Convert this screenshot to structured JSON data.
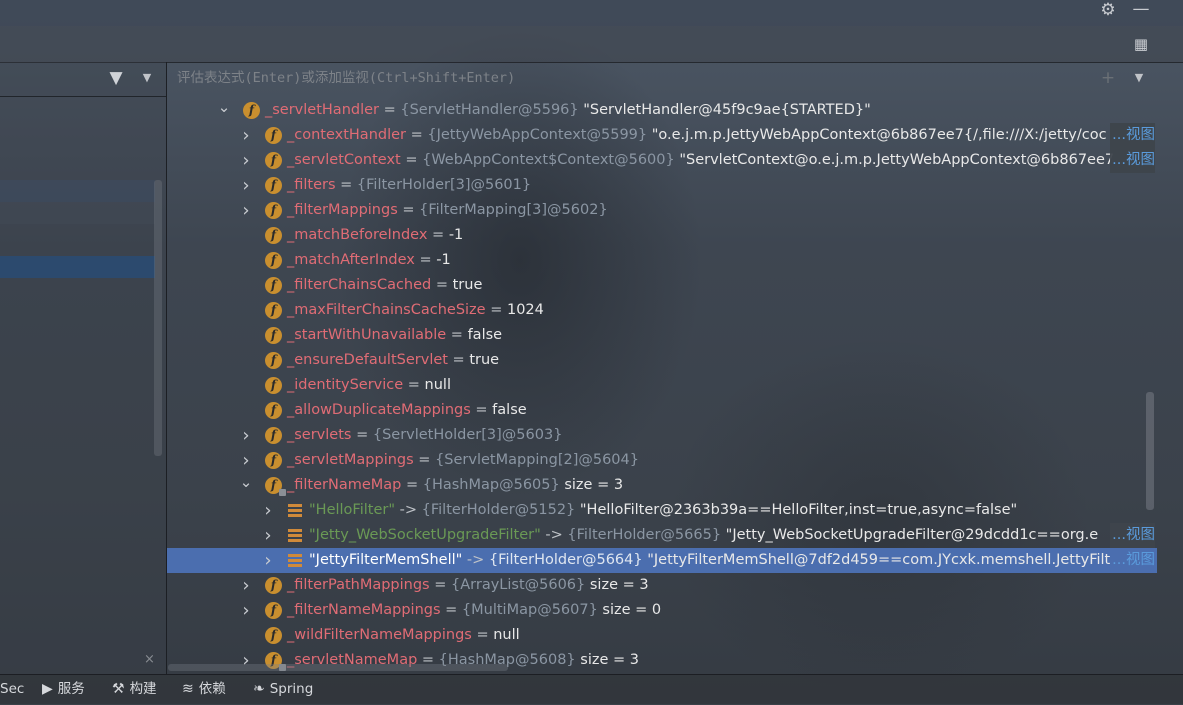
{
  "window": {
    "settings_icon": "gear-icon",
    "minimize_icon": "minimize-icon",
    "layout_icon": "layout-icon"
  },
  "frames_panel": {
    "filter_icon": "filter-icon",
    "close_glyph": "×"
  },
  "watches": {
    "placeholder": "评估表达式(Enter)或添加监视(Ctrl+Shift+Enter)",
    "add_glyph": "+"
  },
  "tree": [
    {
      "indent": 0,
      "toggle": "expanded",
      "icon": "field",
      "name": "_servletHandler",
      "sep": " = ",
      "ref": "{ServletHandler@5596}",
      "value": " \"ServletHandler@45f9c9ae{STARTED}\"",
      "view": ""
    },
    {
      "indent": 1,
      "toggle": "collapsed",
      "icon": "field",
      "name": "_contextHandler",
      "sep": " = ",
      "ref": "{JettyWebAppContext@5599}",
      "value": " \"o.e.j.m.p.JettyWebAppContext@6b867ee7{/,file:///X:/jetty/coc",
      "view": "...视图"
    },
    {
      "indent": 1,
      "toggle": "collapsed",
      "icon": "field",
      "name": "_servletContext",
      "sep": " = ",
      "ref": "{WebAppContext$Context@5600}",
      "value": " \"ServletContext@o.e.j.m.p.JettyWebAppContext@6b867ee7",
      "view": "...视图"
    },
    {
      "indent": 1,
      "toggle": "collapsed",
      "icon": "field",
      "name": "_filters",
      "sep": " = ",
      "ref": "{FilterHolder[3]@5601}",
      "value": "",
      "view": ""
    },
    {
      "indent": 1,
      "toggle": "collapsed",
      "icon": "field",
      "name": "_filterMappings",
      "sep": " = ",
      "ref": "{FilterMapping[3]@5602}",
      "value": "",
      "view": ""
    },
    {
      "indent": 1,
      "toggle": "none",
      "icon": "field",
      "name": "_matchBeforeIndex",
      "sep": " = ",
      "ref": "",
      "value": "-1",
      "view": ""
    },
    {
      "indent": 1,
      "toggle": "none",
      "icon": "field",
      "name": "_matchAfterIndex",
      "sep": " = ",
      "ref": "",
      "value": "-1",
      "view": ""
    },
    {
      "indent": 1,
      "toggle": "none",
      "icon": "field",
      "name": "_filterChainsCached",
      "sep": " = ",
      "ref": "",
      "value": "true",
      "view": ""
    },
    {
      "indent": 1,
      "toggle": "none",
      "icon": "field",
      "name": "_maxFilterChainsCacheSize",
      "sep": " = ",
      "ref": "",
      "value": "1024",
      "view": ""
    },
    {
      "indent": 1,
      "toggle": "none",
      "icon": "field",
      "name": "_startWithUnavailable",
      "sep": " = ",
      "ref": "",
      "value": "false",
      "view": ""
    },
    {
      "indent": 1,
      "toggle": "none",
      "icon": "field",
      "name": "_ensureDefaultServlet",
      "sep": " = ",
      "ref": "",
      "value": "true",
      "view": ""
    },
    {
      "indent": 1,
      "toggle": "none",
      "icon": "field",
      "name": "_identityService",
      "sep": " = ",
      "ref": "",
      "value": "null",
      "view": ""
    },
    {
      "indent": 1,
      "toggle": "none",
      "icon": "field",
      "name": "_allowDuplicateMappings",
      "sep": " = ",
      "ref": "",
      "value": "false",
      "view": ""
    },
    {
      "indent": 1,
      "toggle": "collapsed",
      "icon": "field",
      "name": "_servlets",
      "sep": " = ",
      "ref": "{ServletHolder[3]@5603}",
      "value": "",
      "view": ""
    },
    {
      "indent": 1,
      "toggle": "collapsed",
      "icon": "field",
      "name": "_servletMappings",
      "sep": " = ",
      "ref": "{ServletMapping[2]@5604}",
      "value": "",
      "view": ""
    },
    {
      "indent": 1,
      "toggle": "expanded",
      "icon": "field-locked",
      "name": "_filterNameMap",
      "sep": " = ",
      "ref": "{HashMap@5605}",
      "value": "  size = 3",
      "view": ""
    },
    {
      "indent": 2,
      "toggle": "collapsed",
      "icon": "entry",
      "name": "\"HelloFilter\"",
      "sep": " -> ",
      "ref": "{FilterHolder@5152}",
      "value": " \"HelloFilter@2363b39a==HelloFilter,inst=true,async=false\"",
      "view": ""
    },
    {
      "indent": 2,
      "toggle": "collapsed",
      "icon": "entry",
      "name": "\"Jetty_WebSocketUpgradeFilter\"",
      "sep": " -> ",
      "ref": "{FilterHolder@5665}",
      "value": " \"Jetty_WebSocketUpgradeFilter@29dcdd1c==org.e",
      "view": "...视图"
    },
    {
      "indent": 2,
      "toggle": "collapsed",
      "icon": "entry",
      "name": "\"JettyFilterMemShell\"",
      "sep": " -> ",
      "ref": "{FilterHolder@5664}",
      "value": " \"JettyFilterMemShell@7df2d459==com.JYcxk.memshell.JettyFilt",
      "view": "...视图",
      "selected": true
    },
    {
      "indent": 1,
      "toggle": "collapsed",
      "icon": "field",
      "name": "_filterPathMappings",
      "sep": " = ",
      "ref": "{ArrayList@5606}",
      "value": "  size = 3",
      "view": ""
    },
    {
      "indent": 1,
      "toggle": "collapsed",
      "icon": "field",
      "name": "_filterNameMappings",
      "sep": " = ",
      "ref": "{MultiMap@5607}",
      "value": "  size = 0",
      "view": ""
    },
    {
      "indent": 1,
      "toggle": "none",
      "icon": "field",
      "name": "_wildFilterNameMappings",
      "sep": " = ",
      "ref": "",
      "value": "null",
      "view": ""
    },
    {
      "indent": 1,
      "toggle": "collapsed",
      "icon": "field-locked",
      "name": "_servletNameMap",
      "sep": " = ",
      "ref": "{HashMap@5608}",
      "value": "  size = 3",
      "view": ""
    }
  ],
  "statusbar": [
    {
      "label": "Sec",
      "icon": ""
    },
    {
      "label": "服务",
      "icon": "services-icon"
    },
    {
      "label": "构建",
      "icon": "hammer-icon"
    },
    {
      "label": "依赖",
      "icon": "dependencies-icon"
    },
    {
      "label": "Spring",
      "icon": "spring-leaf-icon"
    }
  ],
  "colors": {
    "field_name": "#e06c75",
    "reference": "#8b96a3",
    "value": "#e8e8e8",
    "link": "#5a9bdc",
    "selection": "#4b6eaf",
    "field_icon": "#c98f2f"
  }
}
